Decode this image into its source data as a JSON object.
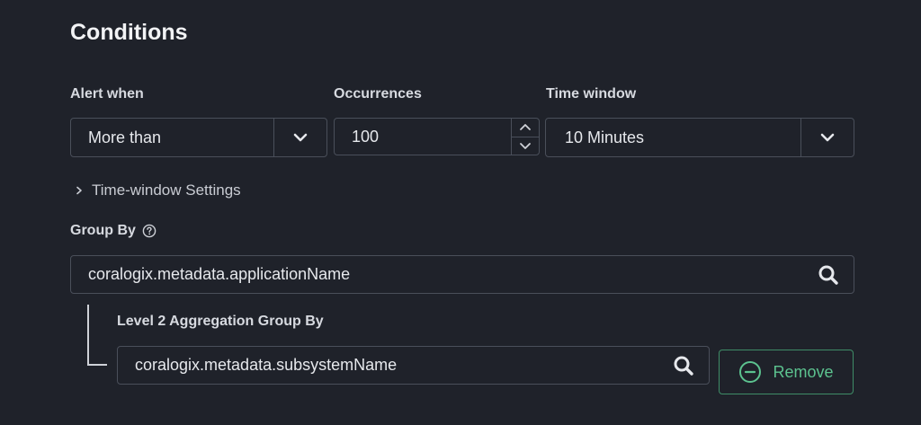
{
  "section": {
    "title": "Conditions"
  },
  "alert_when": {
    "label": "Alert when",
    "value": "More than"
  },
  "occurrences": {
    "label": "Occurrences",
    "value": "100"
  },
  "time_window": {
    "label": "Time window",
    "value": "10 Minutes"
  },
  "time_window_settings": {
    "label": "Time-window Settings"
  },
  "group_by": {
    "label": "Group By",
    "value": "coralogix.metadata.applicationName"
  },
  "level2": {
    "label": "Level 2 Aggregation Group By",
    "value": "coralogix.metadata.subsystemName",
    "remove_label": "Remove"
  },
  "colors": {
    "background": "#1f222a",
    "border": "#4a4f5a",
    "text": "#e6e8ec",
    "accent_green": "#5cc28f"
  },
  "icons": {
    "select_arrow": "chevron-down-icon",
    "stepper_up": "chevron-up-icon",
    "stepper_down": "chevron-down-icon",
    "expand": "chevron-right-icon",
    "help": "question-circle-icon",
    "search": "search-icon",
    "remove": "minus-circle-icon"
  }
}
